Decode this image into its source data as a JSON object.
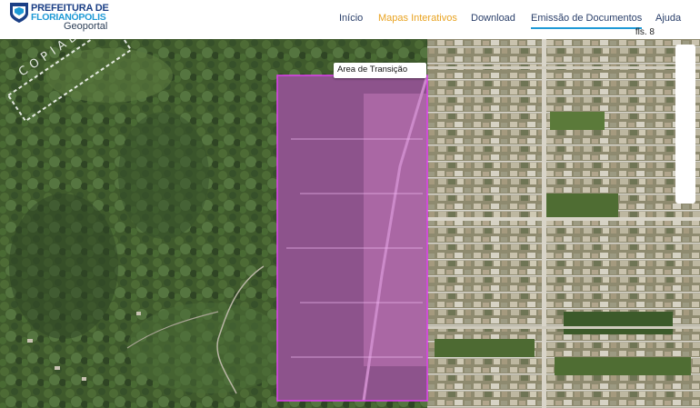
{
  "header": {
    "logo": {
      "line1": "PREFEITURA DE",
      "line2": "FLORIANÓPOLIS",
      "subtitle": "Geoportal"
    },
    "nav": [
      {
        "label": "Início",
        "state": "normal"
      },
      {
        "label": "Mapas Interativos",
        "state": "active"
      },
      {
        "label": "Download",
        "state": "normal"
      },
      {
        "label": "Emissão de Documentos",
        "state": "current"
      },
      {
        "label": "Ajuda",
        "state": "normal"
      }
    ],
    "page_marker": "fls. 8"
  },
  "map": {
    "polygon_label": "Area de Transição",
    "polygon_color": "#d23be0",
    "stamp_text": "COPIAD"
  },
  "colors": {
    "nav_text": "#2a3f6a",
    "nav_active": "#e9a321",
    "nav_underline": "#1e9ad6",
    "brand_dark": "#1b3f86",
    "brand_light": "#1e9ad6"
  }
}
